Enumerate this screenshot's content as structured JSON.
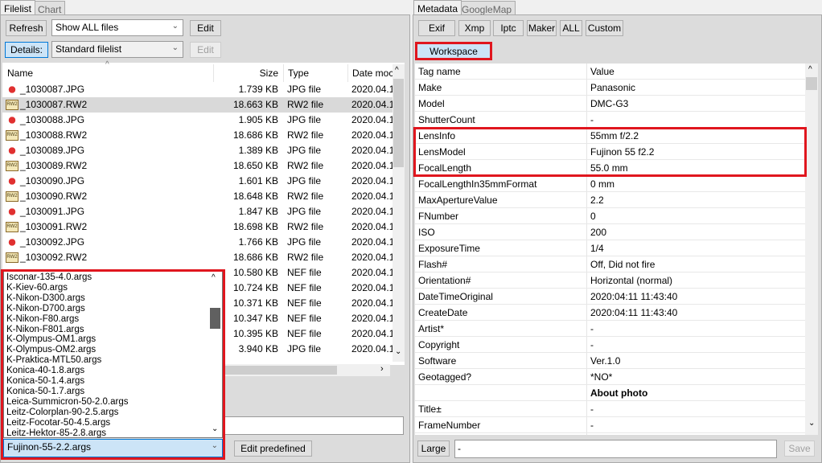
{
  "left": {
    "tabs": [
      "Filelist",
      "Chart"
    ],
    "refresh": "Refresh",
    "filter": "Show ALL files",
    "edit1": "Edit",
    "details": "Details:",
    "view": "Standard filelist",
    "edit2": "Edit",
    "columns": [
      "Name",
      "Size",
      "Type",
      "Date moc"
    ],
    "files": [
      {
        "name": "_1030087.JPG",
        "size": "1.739 KB",
        "type": "JPG file",
        "date": "2020.04.1",
        "kind": "jpg"
      },
      {
        "name": "_1030087.RW2",
        "size": "18.663 KB",
        "type": "RW2 file",
        "date": "2020.04.1",
        "kind": "rw2"
      },
      {
        "name": "_1030088.JPG",
        "size": "1.905 KB",
        "type": "JPG file",
        "date": "2020.04.1",
        "kind": "jpg"
      },
      {
        "name": "_1030088.RW2",
        "size": "18.686 KB",
        "type": "RW2 file",
        "date": "2020.04.1",
        "kind": "rw2"
      },
      {
        "name": "_1030089.JPG",
        "size": "1.389 KB",
        "type": "JPG file",
        "date": "2020.04.1",
        "kind": "jpg"
      },
      {
        "name": "_1030089.RW2",
        "size": "18.650 KB",
        "type": "RW2 file",
        "date": "2020.04.1",
        "kind": "rw2"
      },
      {
        "name": "_1030090.JPG",
        "size": "1.601 KB",
        "type": "JPG file",
        "date": "2020.04.1",
        "kind": "jpg"
      },
      {
        "name": "_1030090.RW2",
        "size": "18.648 KB",
        "type": "RW2 file",
        "date": "2020.04.1",
        "kind": "rw2"
      },
      {
        "name": "_1030091.JPG",
        "size": "1.847 KB",
        "type": "JPG file",
        "date": "2020.04.1",
        "kind": "jpg"
      },
      {
        "name": "_1030091.RW2",
        "size": "18.698 KB",
        "type": "RW2 file",
        "date": "2020.04.1",
        "kind": "rw2"
      },
      {
        "name": "_1030092.JPG",
        "size": "1.766 KB",
        "type": "JPG file",
        "date": "2020.04.1",
        "kind": "jpg"
      },
      {
        "name": "_1030092.RW2",
        "size": "18.686 KB",
        "type": "RW2 file",
        "date": "2020.04.1",
        "kind": "rw2"
      },
      {
        "name": "",
        "size": "10.580 KB",
        "type": "NEF file",
        "date": "2020.04.1",
        "kind": ""
      },
      {
        "name": "",
        "size": "10.724 KB",
        "type": "NEF file",
        "date": "2020.04.1",
        "kind": ""
      },
      {
        "name": "",
        "size": "10.371 KB",
        "type": "NEF file",
        "date": "2020.04.1",
        "kind": ""
      },
      {
        "name": "",
        "size": "10.347 KB",
        "type": "NEF file",
        "date": "2020.04.1",
        "kind": ""
      },
      {
        "name": "",
        "size": "10.395 KB",
        "type": "NEF file",
        "date": "2020.04.1",
        "kind": ""
      },
      {
        "name": "",
        "size": "3.940 KB",
        "type": "JPG file",
        "date": "2020.04.1",
        "kind": ""
      }
    ],
    "selected_row": 1,
    "predefined_options": [
      "Isconar-135-4.0.args",
      "K-Kiev-60.args",
      "K-Nikon-D300.args",
      "K-Nikon-D700.args",
      "K-Nikon-F80.args",
      "K-Nikon-F801.args",
      "K-Olympus-OM1.args",
      "K-Olympus-OM2.args",
      "K-Praktica-MTL50.args",
      "Konica-40-1.8.args",
      "Konica-50-1.4.args",
      "Konica-50-1.7.args",
      "Leica-Summicron-50-2.0.args",
      "Leitz-Colorplan-90-2.5.args",
      "Leitz-Focotar-50-4.5.args",
      "Leitz-Hektor-85-2.8.args"
    ],
    "predefined_selected": "Fujinon-55-2.2.args",
    "edit_predefined": "Edit predefined"
  },
  "right": {
    "tabs": [
      "Metadata",
      "GoogleMap"
    ],
    "buttons": [
      "Exif",
      "Xmp",
      "Iptc",
      "Maker",
      "ALL",
      "Custom"
    ],
    "workspace": "Workspace",
    "columns": [
      "Tag name",
      "Value"
    ],
    "rows": [
      {
        "tag": "Make",
        "value": "Panasonic"
      },
      {
        "tag": "Model",
        "value": "DMC-G3"
      },
      {
        "tag": "ShutterCount",
        "value": "-"
      },
      {
        "tag": "LensInfo",
        "value": "55mm f/2.2"
      },
      {
        "tag": "LensModel",
        "value": "Fujinon 55 f2.2"
      },
      {
        "tag": "FocalLength",
        "value": "55.0 mm"
      },
      {
        "tag": "FocalLengthIn35mmFormat",
        "value": "0 mm"
      },
      {
        "tag": "MaxApertureValue",
        "value": "2.2"
      },
      {
        "tag": "FNumber",
        "value": "0"
      },
      {
        "tag": "ISO",
        "value": "200"
      },
      {
        "tag": "ExposureTime",
        "value": "1/4"
      },
      {
        "tag": "Flash#",
        "value": "Off, Did not fire"
      },
      {
        "tag": "Orientation#",
        "value": "Horizontal (normal)"
      },
      {
        "tag": "DateTimeOriginal",
        "value": "2020:04:11 11:43:40"
      },
      {
        "tag": "CreateDate",
        "value": "2020:04:11 11:43:40"
      },
      {
        "tag": "Artist*",
        "value": "-"
      },
      {
        "tag": "Copyright",
        "value": "-"
      },
      {
        "tag": "Software",
        "value": "Ver.1.0"
      },
      {
        "tag": "Geotagged?",
        "value": "*NO*"
      },
      {
        "tag": "",
        "value": "About photo",
        "bold": true
      },
      {
        "tag": "Title±",
        "value": "-"
      },
      {
        "tag": "FrameNumber",
        "value": "-"
      }
    ],
    "large": "Large",
    "edit_value": "-",
    "save": "Save"
  },
  "colors": {
    "highlight": "#e0161e",
    "selected": "#cce4f7"
  }
}
